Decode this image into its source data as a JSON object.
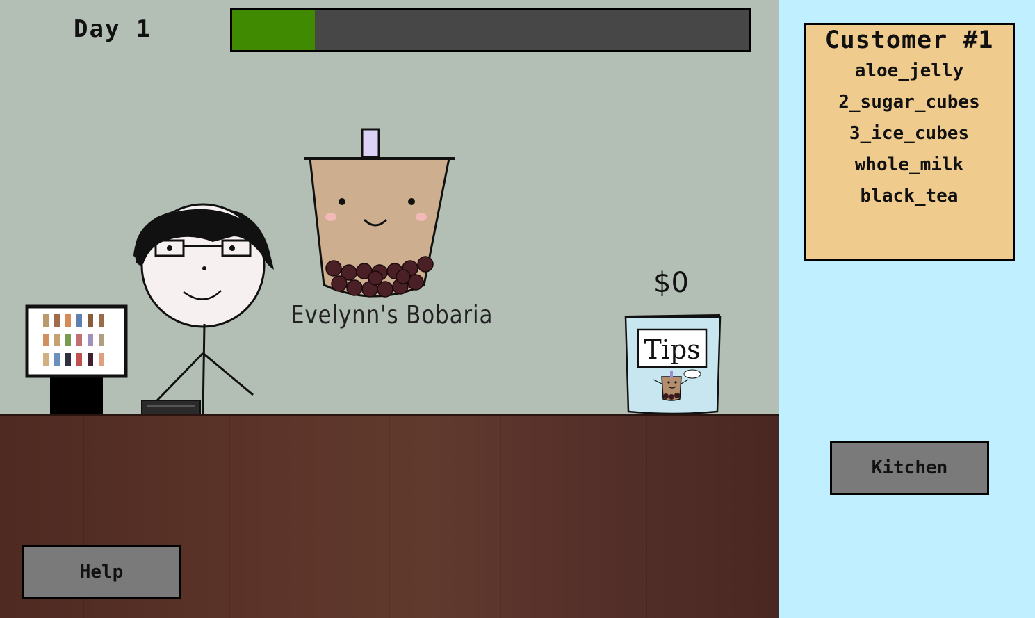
{
  "hud": {
    "day_label": "Day 1",
    "day_progress_percent": 16,
    "progress_fill_color": "#3f8a00",
    "progress_track_color": "#474747"
  },
  "scene": {
    "shop_sign": "Evelynn's Bobaria",
    "tips_amount": "$0",
    "tip_jar_label": "Tips",
    "wall_color": "#b3beb5",
    "counter_color": "#5c3429"
  },
  "buttons": {
    "help_label": "Help",
    "kitchen_label": "Kitchen",
    "button_color": "#7a7a7a"
  },
  "order": {
    "title": "Customer #1",
    "items": [
      "aloe_jelly",
      "2_sugar_cubes",
      "3_ice_cubes",
      "whole_milk",
      "black_tea"
    ],
    "card_color": "#f0cb8e"
  },
  "side_panel": {
    "background_color": "#c0f0ff"
  }
}
